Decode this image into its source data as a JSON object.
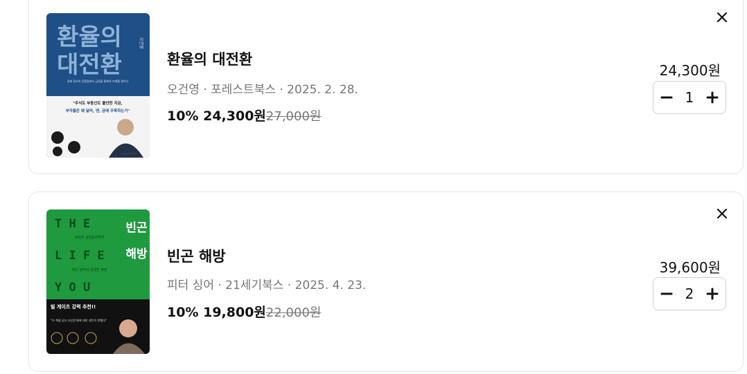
{
  "items": [
    {
      "title": "환율의 대전환",
      "meta": "오건영 · 포레스트북스 · 2025. 2. 28.",
      "discount": "10%",
      "price": "24,300원",
      "original_price": "27,000원",
      "total": "24,300원",
      "quantity": "1",
      "cover": {
        "title_line1": "환율의",
        "title_line2": "대전환",
        "author": "오건영",
        "tagline": "경제 질서의 전환점에서 금융을 통화의 미래를 말하다",
        "quote_line1": "\"주식도 부동산도 불안한 지금,",
        "quote_line2": "부자들은 왜 달러, 엔, 금에 주목하는가\"",
        "publisher": "포레스트북스",
        "bg": "#1e4f86"
      }
    },
    {
      "title": "빈곤 해방",
      "meta": "피터 싱어 · 21세기북스 · 2025. 4. 23.",
      "discount": "10%",
      "price": "19,800원",
      "original_price": "22,000원",
      "total": "39,600원",
      "quantity": "2",
      "cover": {
        "en_row1": "T H E",
        "en_row2": "L I F E",
        "en_row3": "Y O U",
        "ko_title1": "빈곤",
        "ko_title2": "해방",
        "subtitle1": "세계적 실천윤리학자",
        "subtitle2": "피터 싱어의 강대한 제언",
        "banner": "빌 게이츠 강력 추천!!",
        "quote": "\"이 책을 읽고 자선단체에 대한 생각이 변했다\"",
        "bg": "#1f9a3e"
      }
    }
  ],
  "icons": {
    "close": "close-icon",
    "minus": "minus-icon",
    "plus": "plus-icon"
  }
}
